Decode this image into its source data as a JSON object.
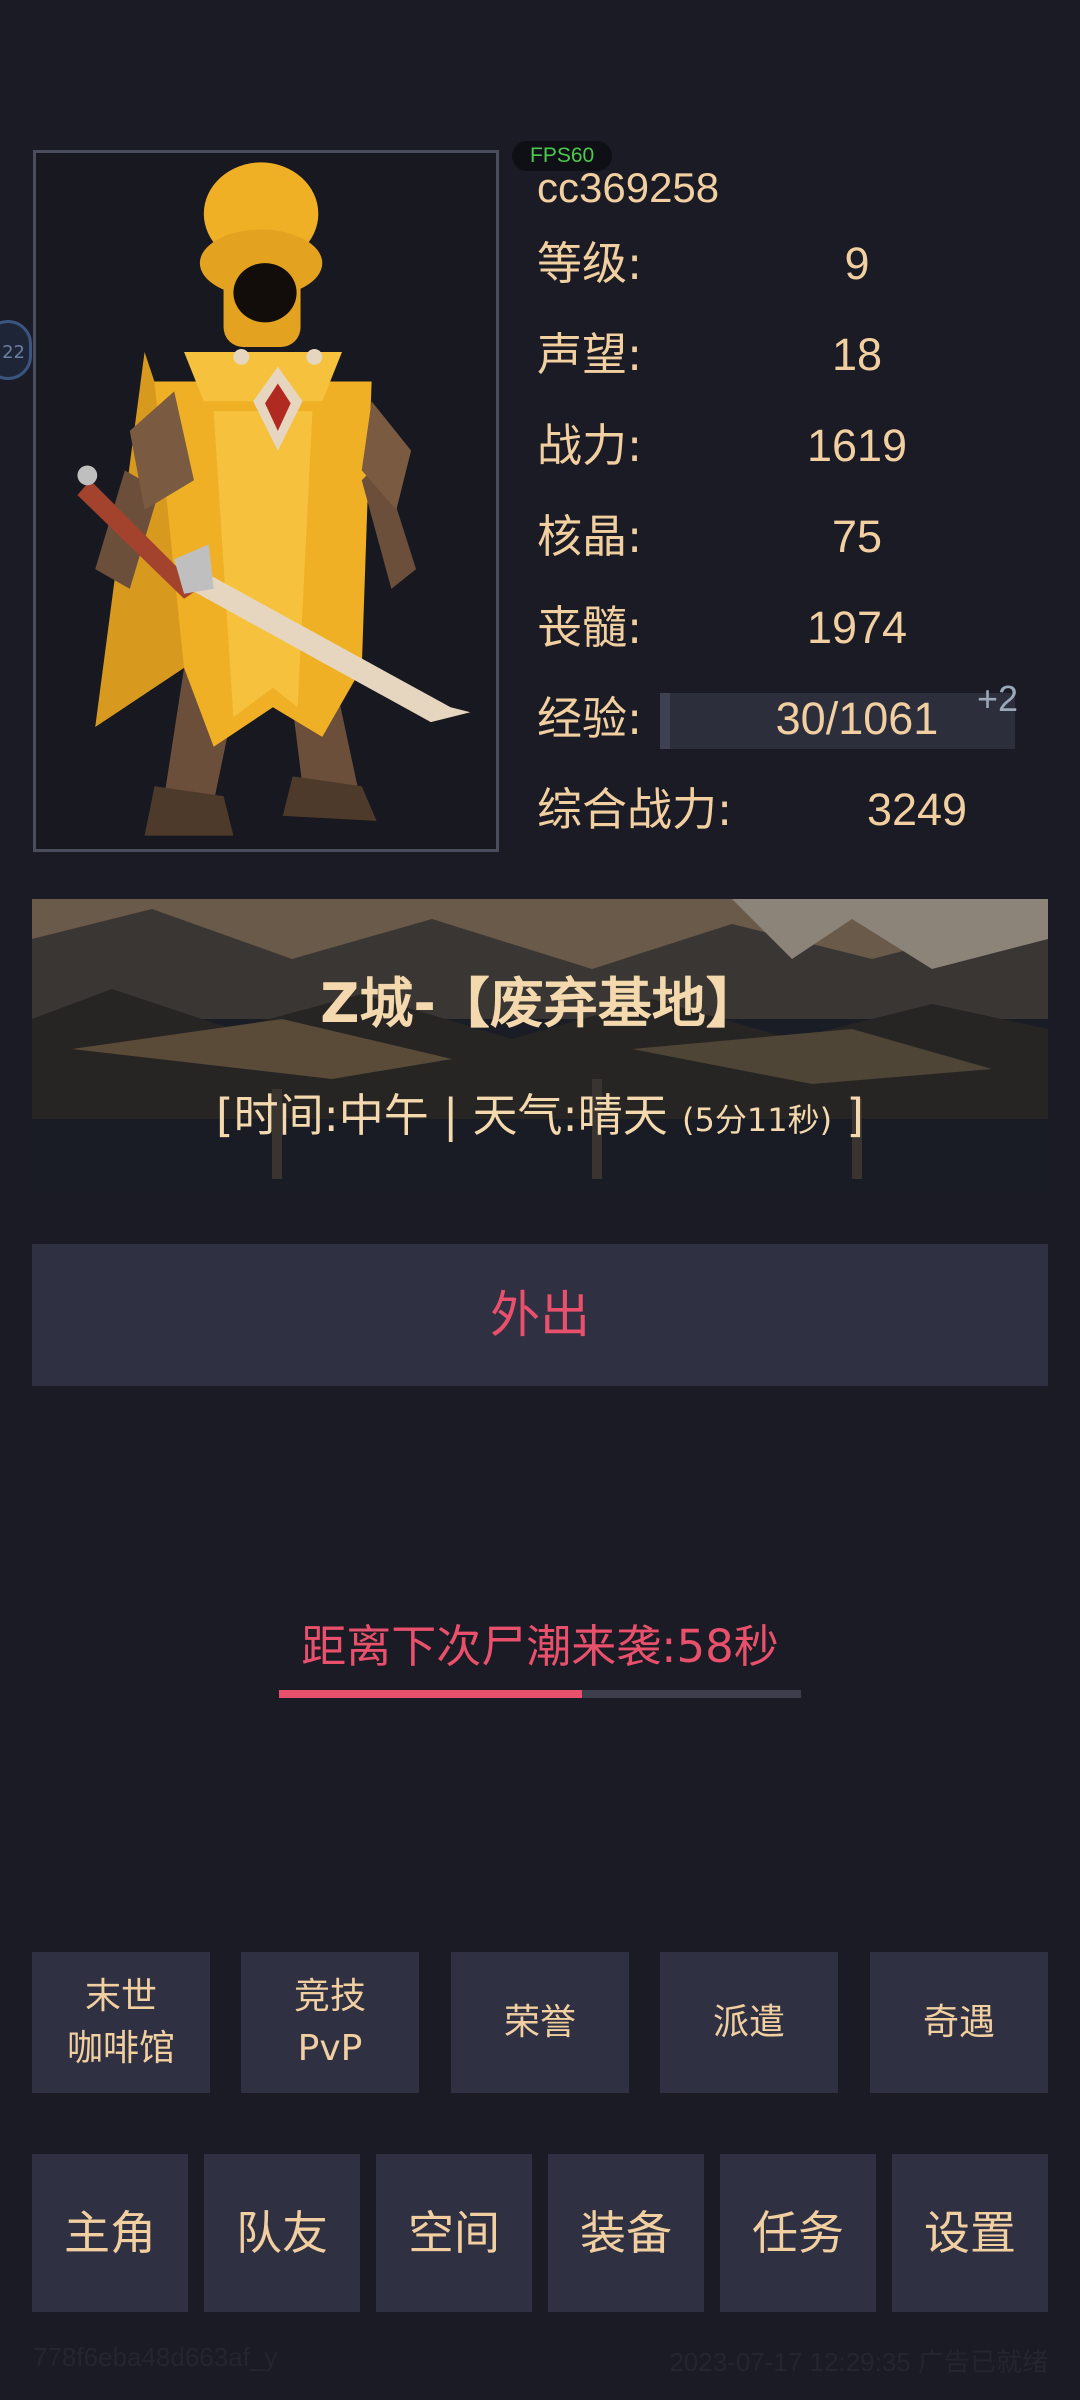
{
  "fps": "FPS60",
  "side_bubble": "22",
  "player": {
    "username": "cc369258",
    "stats": [
      {
        "label": "等级:",
        "value": "9"
      },
      {
        "label": "声望:",
        "value": "18"
      },
      {
        "label": "战力:",
        "value": "1619"
      },
      {
        "label": "核晶:",
        "value": "75"
      },
      {
        "label": "丧髓:",
        "value": "1974"
      }
    ],
    "exp": {
      "label": "经验:",
      "value": "30/1061",
      "bonus": "+2"
    },
    "total": {
      "label": "综合战力:",
      "value": "3249"
    }
  },
  "location": {
    "title": "Z城-【废弃基地】",
    "time_weather": "[时间:中午 | 天气:晴天",
    "remaining": "(5分11秒)",
    "close_bracket": "]"
  },
  "go_out_label": "外出",
  "countdown": {
    "text": "距离下次尸潮来袭:58秒",
    "progress": 0.58
  },
  "features": [
    {
      "line1": "末世",
      "line2": "咖啡馆"
    },
    {
      "line1": "竞技",
      "line2": "PvP"
    },
    {
      "line1": "荣誉",
      "line2": ""
    },
    {
      "line1": "派遣",
      "line2": ""
    },
    {
      "line1": "奇遇",
      "line2": ""
    }
  ],
  "nav": [
    "主角",
    "队友",
    "空间",
    "装备",
    "任务",
    "设置"
  ],
  "footer": {
    "id": "778f6eba48d663af_y",
    "status": "2023-07-17 12:29:35 广告已就绪"
  },
  "colors": {
    "background": "#1a1b24",
    "button": "#2f3142",
    "accent_red": "#e8506c",
    "text_gold": "#f1cfa0",
    "fps_green": "#4cc94c"
  }
}
